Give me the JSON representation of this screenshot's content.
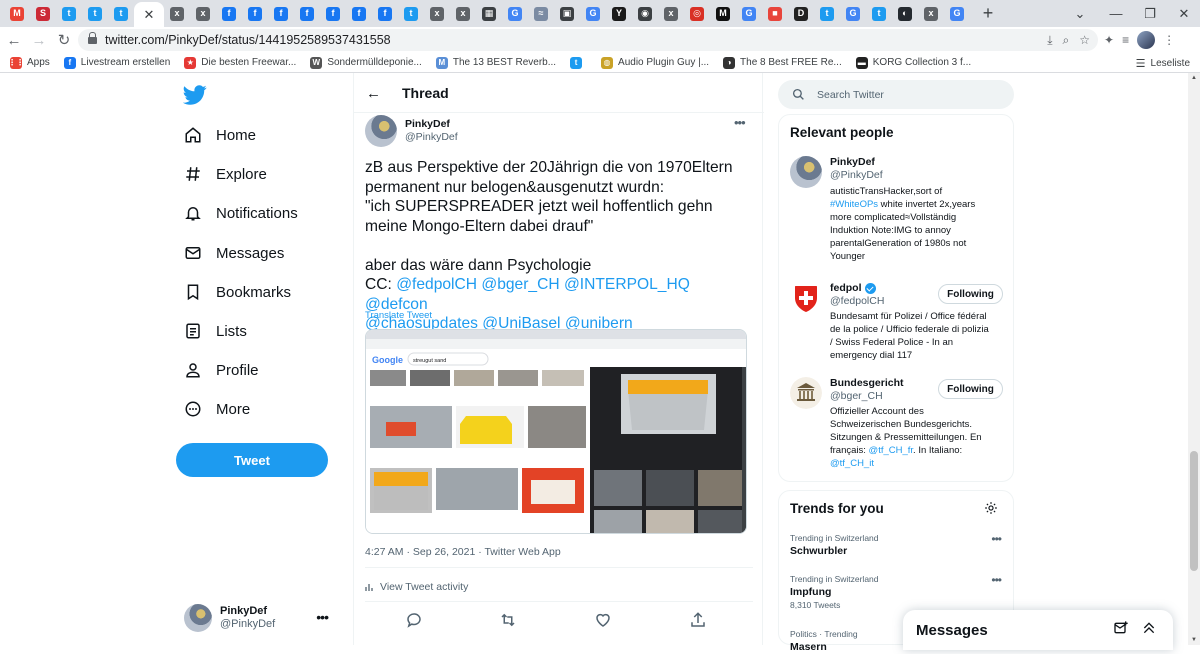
{
  "browser": {
    "url": "twitter.com/PinkyDef/status/1441952589537431558",
    "tabs": [
      {
        "icon": "M",
        "bg": "#ea4335"
      },
      {
        "icon": "S",
        "bg": "#cc2a36"
      },
      {
        "icon": "t",
        "bg": "#1d9bf0"
      },
      {
        "icon": "t",
        "bg": "#1d9bf0"
      },
      {
        "icon": "t",
        "bg": "#1d9bf0"
      },
      {
        "icon": "x",
        "bg": "#5f6368"
      },
      {
        "icon": "x",
        "bg": "#5f6368"
      },
      {
        "icon": "f",
        "bg": "#1877f2"
      },
      {
        "icon": "f",
        "bg": "#1877f2"
      },
      {
        "icon": "f",
        "bg": "#1877f2"
      },
      {
        "icon": "f",
        "bg": "#1877f2"
      },
      {
        "icon": "f",
        "bg": "#1877f2"
      },
      {
        "icon": "f",
        "bg": "#1877f2"
      },
      {
        "icon": "f",
        "bg": "#1877f2"
      },
      {
        "icon": "t",
        "bg": "#1d9bf0"
      },
      {
        "icon": "x",
        "bg": "#5f6368"
      },
      {
        "icon": "x",
        "bg": "#5f6368"
      },
      {
        "icon": "▦",
        "bg": "#3c4043"
      },
      {
        "icon": "G",
        "bg": "#4285f4"
      },
      {
        "icon": "≈",
        "bg": "#7b8ba3"
      },
      {
        "icon": "▣",
        "bg": "#3c4043"
      },
      {
        "icon": "G",
        "bg": "#4285f4"
      },
      {
        "icon": "Y",
        "bg": "#1a1a1a"
      },
      {
        "icon": "◉",
        "bg": "#3c4043"
      },
      {
        "icon": "x",
        "bg": "#5f6368"
      },
      {
        "icon": "◎",
        "bg": "#d93025"
      },
      {
        "icon": "M",
        "bg": "#111111"
      },
      {
        "icon": "G",
        "bg": "#4285f4"
      },
      {
        "icon": "■",
        "bg": "#e8453c"
      },
      {
        "icon": "D",
        "bg": "#222222"
      },
      {
        "icon": "t",
        "bg": "#1d9bf0"
      },
      {
        "icon": "G",
        "bg": "#4285f4"
      },
      {
        "icon": "t",
        "bg": "#1d9bf0"
      },
      {
        "icon": "◐",
        "bg": "#24292f"
      },
      {
        "icon": "x",
        "bg": "#5f6368"
      },
      {
        "icon": "G",
        "bg": "#4285f4"
      }
    ],
    "bookmarks": [
      {
        "label": "Apps",
        "icon": "⋮⋮",
        "bg": "#ea4335"
      },
      {
        "label": "Livestream erstellen",
        "icon": "f",
        "bg": "#1877f2"
      },
      {
        "label": "Die besten Freewar...",
        "icon": "★",
        "bg": "#e53935"
      },
      {
        "label": "Sondermülldeponie...",
        "icon": "W",
        "bg": "#555555"
      },
      {
        "label": "The 13 BEST Reverb...",
        "icon": "M",
        "bg": "#5a8fd6"
      },
      {
        "label": "",
        "icon": "t",
        "bg": "#1d9bf0"
      },
      {
        "label": "Audio Plugin Guy |...",
        "icon": "◍",
        "bg": "#c9a227"
      },
      {
        "label": "The 8 Best FREE Re...",
        "icon": "◑",
        "bg": "#333333"
      },
      {
        "label": "KORG Collection 3 f...",
        "icon": "▬",
        "bg": "#222222"
      }
    ],
    "reading_list": "Leseliste"
  },
  "nav": {
    "items": [
      {
        "label": "Home",
        "icon": "home-icon"
      },
      {
        "label": "Explore",
        "icon": "hashtag-icon"
      },
      {
        "label": "Notifications",
        "icon": "bell-icon"
      },
      {
        "label": "Messages",
        "icon": "envelope-icon"
      },
      {
        "label": "Bookmarks",
        "icon": "bookmark-icon"
      },
      {
        "label": "Lists",
        "icon": "list-icon"
      },
      {
        "label": "Profile",
        "icon": "person-icon"
      },
      {
        "label": "More",
        "icon": "more-circle-icon"
      }
    ],
    "tweet_button": "Tweet",
    "account": {
      "name": "PinkyDef",
      "handle": "@PinkyDef"
    }
  },
  "thread": {
    "title": "Thread",
    "author": {
      "name": "PinkyDef",
      "handle": "@PinkyDef"
    },
    "text_line1": "zB aus Perspektive der 20Jährign die von 1970Eltern\npermanent nur belogen&ausgenutzt wurdn:\n\"ich SUPERSPREADER jetzt weil hoffentlich gehn\nmeine Mongo-Eltern dabei drauf\"\n\naber das wäre dann Psychologie\nCC: ",
    "mention_fedpol": "@fedpolCH",
    "mention_bger": "@bger_CH",
    "mention_interpol": "@INTERPOL_HQ",
    "mention_defcon": "@defcon",
    "mention_chaos": "@chaosupdates",
    "mention_unibasel": "@UniBasel",
    "mention_unibern": "@unibern",
    "translate": "Translate Tweet",
    "timestamp": "4:27 AM · Sep 26, 2021 · Twitter Web App",
    "activity": "View Tweet activity",
    "image": {
      "search_query": "streugut sand"
    }
  },
  "sidebar": {
    "search_placeholder": "Search Twitter",
    "relevant_title": "Relevant people",
    "people": [
      {
        "name": "PinkyDef",
        "handle": "@PinkyDef",
        "bio_a": "autisticTransHacker,sort of\n",
        "bio_link": "#WhiteOPs",
        "bio_b": " white invertet 2x,years\nmore complicated≈Vollständig\nInduktion Note:IMG to annoy\nparentalGeneration of 1980s not\nYounger",
        "follow": ""
      },
      {
        "name": "fedpol",
        "handle": "@fedpolCH",
        "bio": "Bundesamt für Polizei / Office fédéral\nde la police / Ufficio federale di polizia\n/ Swiss Federal Police - In an\nemergency dial 117",
        "follow": "Following"
      },
      {
        "name": "Bundesgericht",
        "handle": "@bger_CH",
        "bio_a": "Offizieller Account des\nSchweizerischen Bundesgerichts.\nSitzungen & Pressemitteilungen. En\nfrançais: ",
        "bio_link1": "@tf_CH_fr",
        "bio_b": ". In Italiano:\n",
        "bio_link2": "@tf_CH_it",
        "follow": "Following"
      }
    ],
    "trends_title": "Trends for you",
    "trends": [
      {
        "meta": "Trending in Switzerland",
        "name": "Schwurbler",
        "count": ""
      },
      {
        "meta": "Trending in Switzerland",
        "name": "Impfung",
        "count": "8,310 Tweets"
      },
      {
        "meta": "Politics · Trending",
        "name": "Masern",
        "count": ""
      }
    ],
    "messages_drawer": "Messages"
  },
  "colors": {
    "accent": "#1d9bf0",
    "text": "#0f1419",
    "muted": "#536471"
  }
}
